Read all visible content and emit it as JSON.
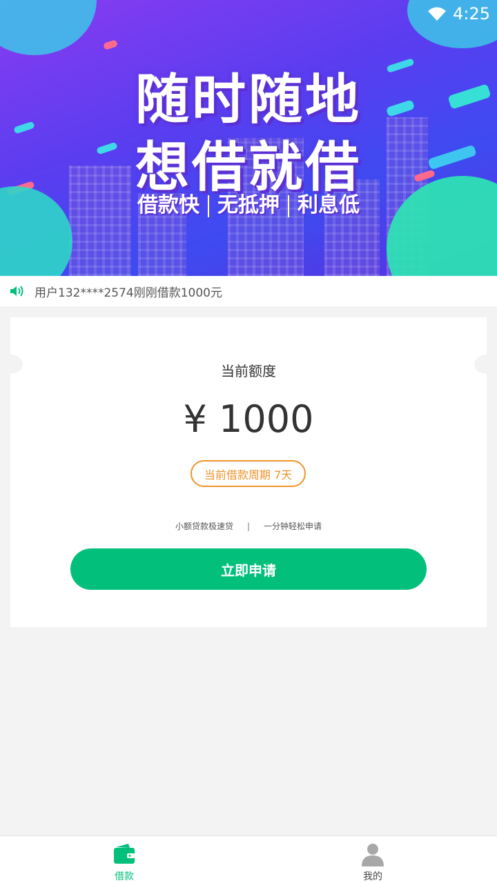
{
  "status_bar": {
    "time": "4:25"
  },
  "banner": {
    "headline_line1": "随时随地",
    "headline_line2": "想借就借",
    "tags": [
      "借款快",
      "无抵押",
      "利息低"
    ]
  },
  "notice": {
    "text": "用户132****2574刚刚借款1000元"
  },
  "card": {
    "label": "当前额度",
    "amount": "¥ 1000",
    "period_badge": "当前借款周期  7天",
    "features": [
      "小额贷款极速贷",
      "|",
      "一分钟轻松申请"
    ],
    "apply_label": "立即申请"
  },
  "tabbar": {
    "items": [
      {
        "label": "借款",
        "icon": "wallet-icon",
        "active": true
      },
      {
        "label": "我的",
        "icon": "user-icon",
        "active": false
      }
    ]
  },
  "colors": {
    "accent": "#03bf7c",
    "badge": "#f0922b",
    "banner_purple": "#5b3df0"
  }
}
